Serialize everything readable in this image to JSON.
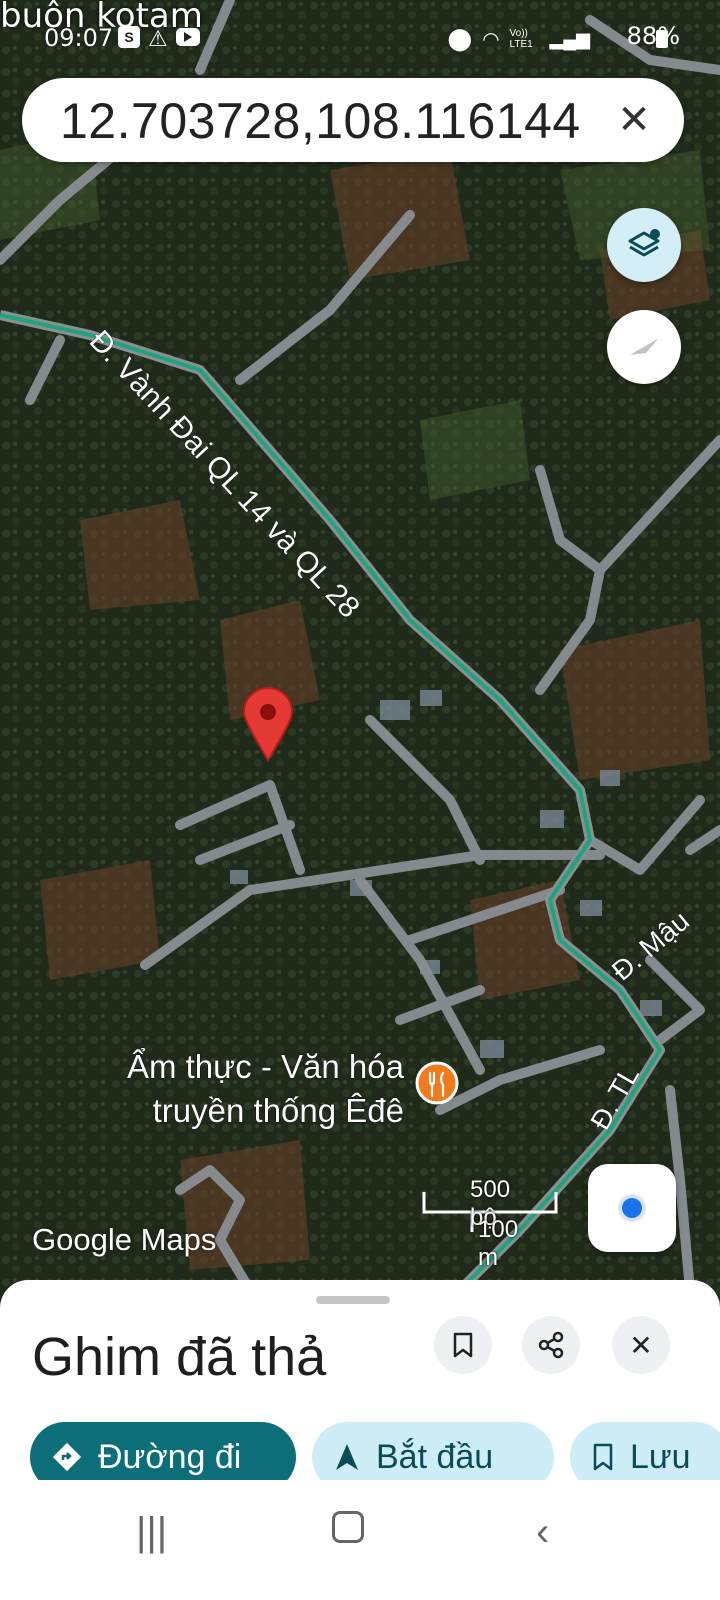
{
  "status_bar": {
    "time": "09:07",
    "battery": "88%",
    "icons": [
      "samsung-pay-icon",
      "alert-icon",
      "youtube-icon",
      "location-icon",
      "wifi-icon",
      "volte-icon",
      "signal-icon",
      "battery-icon"
    ],
    "volte_label": "Vo)) LTE1"
  },
  "search": {
    "query": "12.703728,108.116144"
  },
  "map": {
    "place_label_top": "buôn kotam",
    "road_label_main": "Đ. Vành Đai QL 14 và QL 28",
    "road_label_mau": "Đ. Mậu",
    "road_label_tl": "Đ. TL",
    "poi_line1": "Ẩm thực - Văn hóa",
    "poi_line2": "truyền thống Êđê",
    "scale_top": "500 bộ",
    "scale_bottom": "100 m",
    "brand": "Google Maps",
    "route_color": "#1fa37a",
    "pin_color": "#e53935",
    "poi_color": "#f07b1d"
  },
  "sheet": {
    "title": "Ghim đã thả",
    "buttons": {
      "directions": "Đường đi",
      "start": "Bắt đầu",
      "save": "Lưu"
    }
  },
  "colors": {
    "accent": "#0b6e78",
    "chip": "#cdeef7"
  }
}
